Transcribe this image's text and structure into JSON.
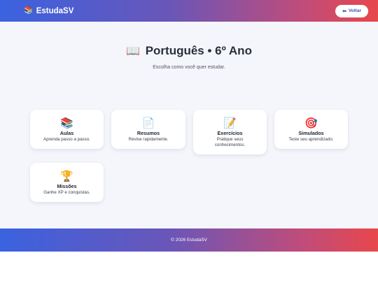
{
  "header": {
    "brand_icon": "📚",
    "brand_name": "EstudaSV",
    "back_arrow": "⬅",
    "back_label": "Voltar"
  },
  "main": {
    "title_icon": "📖",
    "title": "Português • 6º Ano",
    "subtitle": "Escolha como você quer estudar.",
    "cards": [
      {
        "icon": "📚",
        "title": "Aulas",
        "desc": "Aprenda passo a passo."
      },
      {
        "icon": "📄",
        "title": "Resumos",
        "desc": "Revise rapidamente."
      },
      {
        "icon": "📝",
        "title": "Exercícios",
        "desc": "Pratique seus conhecimentos."
      },
      {
        "icon": "🎯",
        "title": "Simulados",
        "desc": "Teste seu aprendizado."
      },
      {
        "icon": "🏆",
        "title": "Missões",
        "desc": "Ganhe XP e conquistas."
      }
    ]
  },
  "footer": {
    "text": "© 2026 EstudaSV"
  },
  "colors": {
    "gradient_start": "#3b62e0",
    "gradient_end": "#e8474c",
    "background": "#f4f6fb",
    "card": "#ffffff"
  }
}
